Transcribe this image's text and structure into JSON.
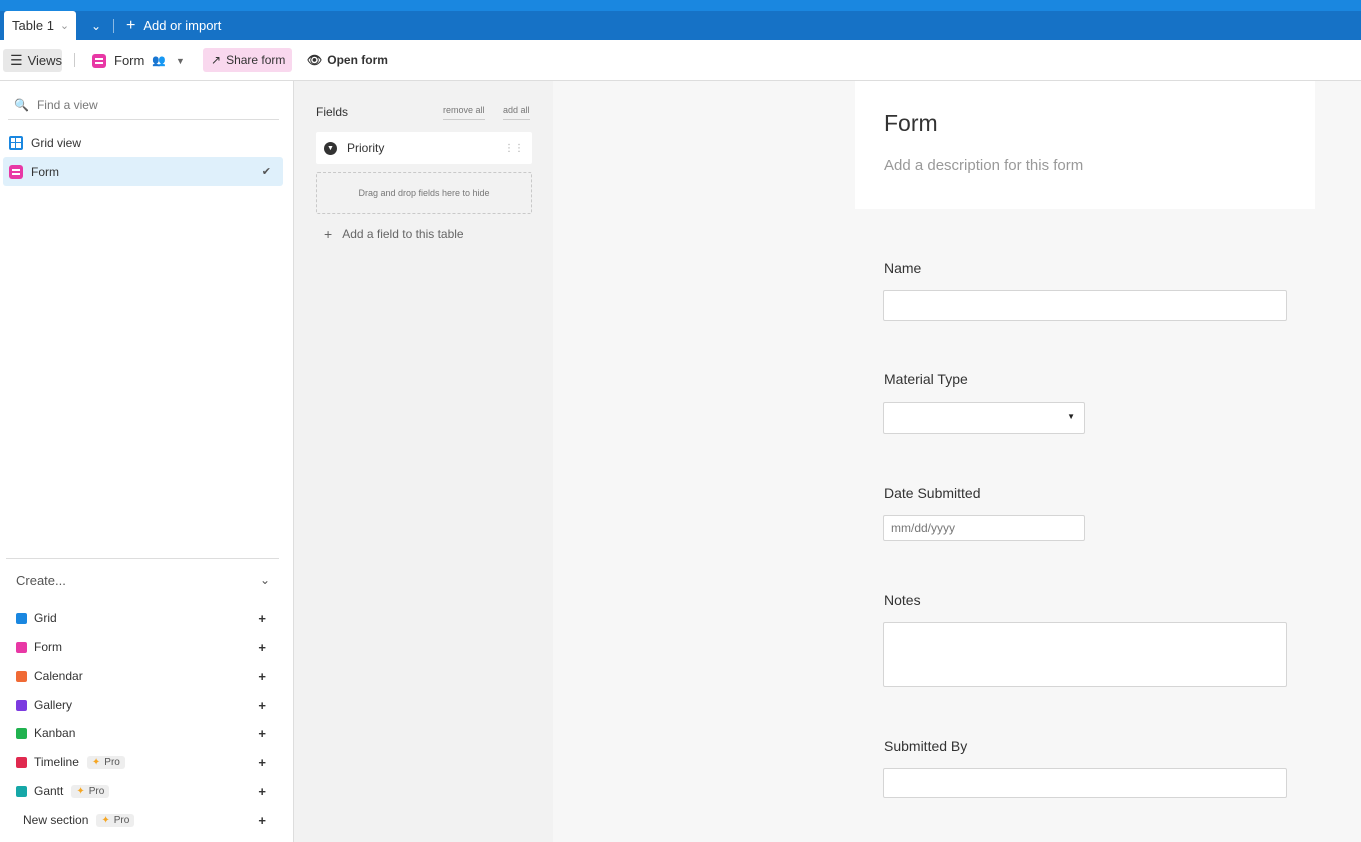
{
  "tabs": {
    "active": "Table 1",
    "add_import": "Add or import"
  },
  "toolbar": {
    "views_label": "Views",
    "view_name": "Form",
    "share_label": "Share form",
    "open_label": "Open form",
    "colors": {
      "form_accent": "#e838a5",
      "share_bg": "#f9d8ee"
    }
  },
  "sidebar": {
    "search_placeholder": "Find a view",
    "views": [
      {
        "label": "Grid view",
        "icon": "grid-icon",
        "selected": false
      },
      {
        "label": "Form",
        "icon": "form-icon",
        "selected": true
      }
    ],
    "create_label": "Create...",
    "create_items": [
      {
        "label": "Grid",
        "color": "#1a87e0",
        "pro": ""
      },
      {
        "label": "Form",
        "color": "#e838a5",
        "pro": ""
      },
      {
        "label": "Calendar",
        "color": "#f06a35",
        "pro": ""
      },
      {
        "label": "Gallery",
        "color": "#7c3be0",
        "pro": ""
      },
      {
        "label": "Kanban",
        "color": "#20b24f",
        "pro": ""
      },
      {
        "label": "Timeline",
        "color": "#e0294f",
        "pro": "Pro"
      },
      {
        "label": "Gantt",
        "color": "#16a7a7",
        "pro": "Pro"
      },
      {
        "label": "New section",
        "color": "",
        "pro": "Pro"
      }
    ]
  },
  "fields_panel": {
    "title": "Fields",
    "remove_all": "remove all",
    "add_all": "add all",
    "hidden_field": "Priority",
    "drop_hint": "Drag and drop fields here to hide",
    "add_field": "Add a field to this table"
  },
  "form": {
    "title": "Form",
    "description_placeholder": "Add a description for this form",
    "fields": {
      "name": "Name",
      "material_type": "Material Type",
      "date_submitted": "Date Submitted",
      "date_placeholder": "mm/dd/yyyy",
      "notes": "Notes",
      "submitted_by": "Submitted By"
    }
  }
}
